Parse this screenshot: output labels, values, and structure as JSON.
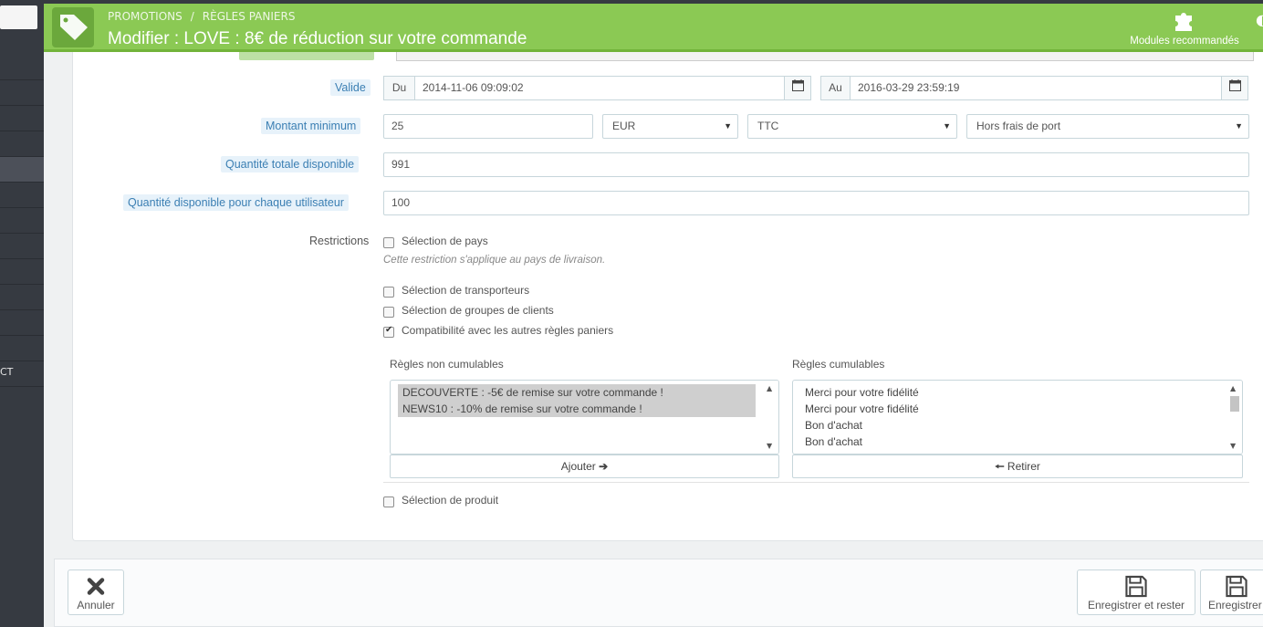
{
  "sidebar": {
    "partial_text": "CT"
  },
  "header": {
    "breadcrumb": [
      "PROMOTIONS",
      "RÈGLES PANIERS"
    ],
    "breadcrumb_separator": "/",
    "title": "Modifier : LOVE : 8€ de réduction sur votre commande",
    "modules_label": "Modules recommandés",
    "header_color": "#8bc954"
  },
  "form": {
    "valid": {
      "label": "Valide",
      "from_addon": "Du",
      "from_value": "2014-11-06 09:09:02",
      "to_addon": "Au",
      "to_value": "2016-03-29 23:59:19"
    },
    "minimum": {
      "label": "Montant minimum",
      "value": "25",
      "currency": "EUR",
      "tax": "TTC",
      "shipping": "Hors frais de port"
    },
    "total_quantity": {
      "label": "Quantité totale disponible",
      "value": "991"
    },
    "per_user_quantity": {
      "label": "Quantité disponible pour chaque utilisateur",
      "value": "100"
    },
    "restrictions": {
      "label": "Restrictions",
      "country": {
        "label": "Sélection de pays",
        "checked": false
      },
      "country_hint": "Cette restriction s'applique au pays de livraison.",
      "carrier": {
        "label": "Sélection de transporteurs",
        "checked": false
      },
      "groups": {
        "label": "Sélection de groupes de clients",
        "checked": false
      },
      "compat": {
        "label": "Compatibilité avec les autres règles paniers",
        "checked": true
      },
      "non_cumulative_title": "Règles non cumulables",
      "non_cumulative": [
        "DECOUVERTE : -5€ de remise sur votre commande !",
        "NEWS10 : -10% de remise sur votre commande !"
      ],
      "cumulative_title": "Règles cumulables",
      "cumulative": [
        "Merci pour votre fidélité",
        "Merci pour votre fidélité",
        "Bon d'achat",
        "Bon d'achat"
      ],
      "add_label": "Ajouter",
      "remove_label": "Retirer",
      "product": {
        "label": "Sélection de produit",
        "checked": false
      }
    }
  },
  "footer": {
    "cancel_label": "Annuler",
    "save_stay_label": "Enregistrer et rester",
    "save_label": "Enregistrer"
  }
}
